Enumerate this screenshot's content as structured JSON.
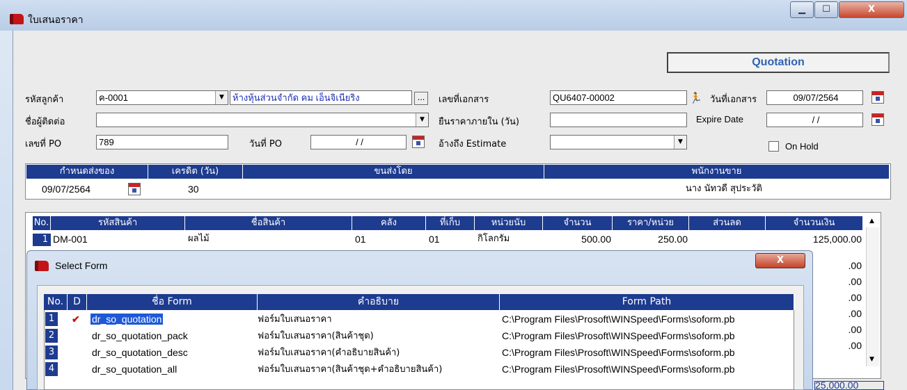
{
  "window": {
    "title": "ใบเสนอราคา",
    "min": "▁",
    "max": "☐",
    "close": "X"
  },
  "doc_type": "Quotation",
  "form": {
    "customer_code_label": "รหัสลูกค้า",
    "customer_code": "ค-0001",
    "customer_name": "ห้างหุ้นส่วนจำกัด คม เอ็นจิเนียริง",
    "dots": "...",
    "contact_label": "ชื่อผู้ติดต่อ",
    "contact": "",
    "po_no_label": "เลขที่ PO",
    "po_no": "789",
    "po_date_label": "วันที่ PO",
    "po_date": "/ /",
    "doc_no_label": "เลขที่เอกสาร",
    "doc_no": "QU6407-00002",
    "confirm_days_label": "ยืนราคาภายใน (วัน)",
    "confirm_days": "",
    "ref_estimate_label": "อ้างถึง Estimate",
    "ref_estimate": "",
    "doc_date_label": "วันที่เอกสาร",
    "doc_date": "09/07/2564",
    "expire_label": "Expire Date",
    "expire_date": "/ /",
    "on_hold_label": "On Hold"
  },
  "delivery": {
    "headers": [
      "กำหนดส่งของ",
      "เครดิต (วัน)",
      "ขนส่งโดย",
      "พนักงานขาย"
    ],
    "values": [
      "09/07/2564",
      "30",
      "",
      "นาง นัทวดี สุประวัติ"
    ]
  },
  "items": {
    "headers": [
      "No.",
      "รหัสสินค้า",
      "ชื่อสินค้า",
      "คลัง",
      "ที่เก็บ",
      "หน่วยนับ",
      "จำนวน",
      "ราคา/หน่วย",
      "ส่วนลด",
      "จำนวนเงิน"
    ],
    "row": {
      "no": "1",
      "code": "DM-001",
      "name": "ผลไม้",
      "wh": "01",
      "loc": "01",
      "unit": "กิโลกรัม",
      "qty": "500.00",
      "price": "250.00",
      "disc": "",
      "amount": "125,000.00"
    },
    "amounts_below": [
      ".00",
      ".00",
      ".00",
      ".00",
      ".00",
      ".00"
    ],
    "total_partial": "25,000.00"
  },
  "dialog": {
    "title": "Select Form",
    "close": "X",
    "headers": [
      "No.",
      "D",
      "ชื่อ Form",
      "คำอธิบาย",
      "Form Path"
    ],
    "rows": [
      {
        "no": "1",
        "check": "✔",
        "name": "dr_so_quotation",
        "desc": "ฟอร์มใบเสนอราคา",
        "path": "C:\\Program Files\\Prosoft\\WINSpeed\\Forms\\soform.pb"
      },
      {
        "no": "2",
        "check": "",
        "name": "dr_so_quotation_pack",
        "desc": "ฟอร์มใบเสนอราคา(สินค้าชุด)",
        "path": "C:\\Program Files\\Prosoft\\WINSpeed\\Forms\\soform.pb"
      },
      {
        "no": "3",
        "check": "",
        "name": "dr_so_quotation_desc",
        "desc": "ฟอร์มใบเสนอราคา(คำอธิบายสินค้า)",
        "path": "C:\\Program Files\\Prosoft\\WINSpeed\\Forms\\soform.pb"
      },
      {
        "no": "4",
        "check": "",
        "name": "dr_so_quotation_all",
        "desc": "ฟอร์มใบเสนอราคา(สินค้าชุด+คำอธิบายสินค้า)",
        "path": "C:\\Program Files\\Prosoft\\WINSpeed\\Forms\\soform.pb"
      }
    ]
  }
}
